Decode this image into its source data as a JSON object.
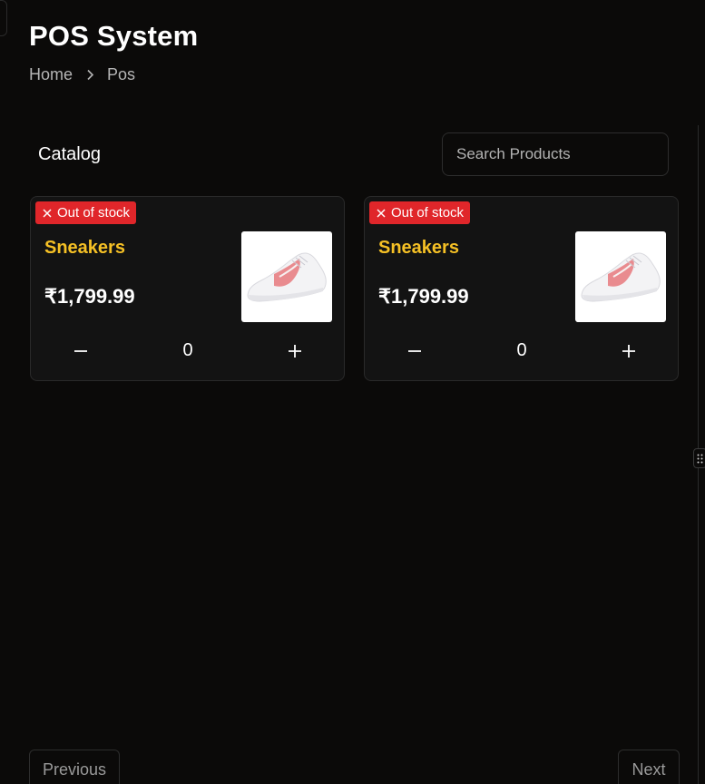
{
  "header": {
    "title": "POS System",
    "breadcrumb": [
      {
        "label": "Home"
      },
      {
        "label": "Pos"
      }
    ]
  },
  "catalog": {
    "title": "Catalog",
    "search": {
      "placeholder": "Search Products",
      "value": ""
    }
  },
  "products": [
    {
      "badge": "Out of stock",
      "name": "Sneakers",
      "price": "₹1,799.99",
      "quantity": "0",
      "image_icon": "sneaker-image"
    },
    {
      "badge": "Out of stock",
      "name": "Sneakers",
      "price": "₹1,799.99",
      "quantity": "0",
      "image_icon": "sneaker-image"
    }
  ],
  "pagination": {
    "previous_label": "Previous",
    "next_label": "Next"
  },
  "colors": {
    "background": "#0b0a09",
    "card": "#131313",
    "accent_name": "#f5c025",
    "badge": "#e0262a"
  }
}
